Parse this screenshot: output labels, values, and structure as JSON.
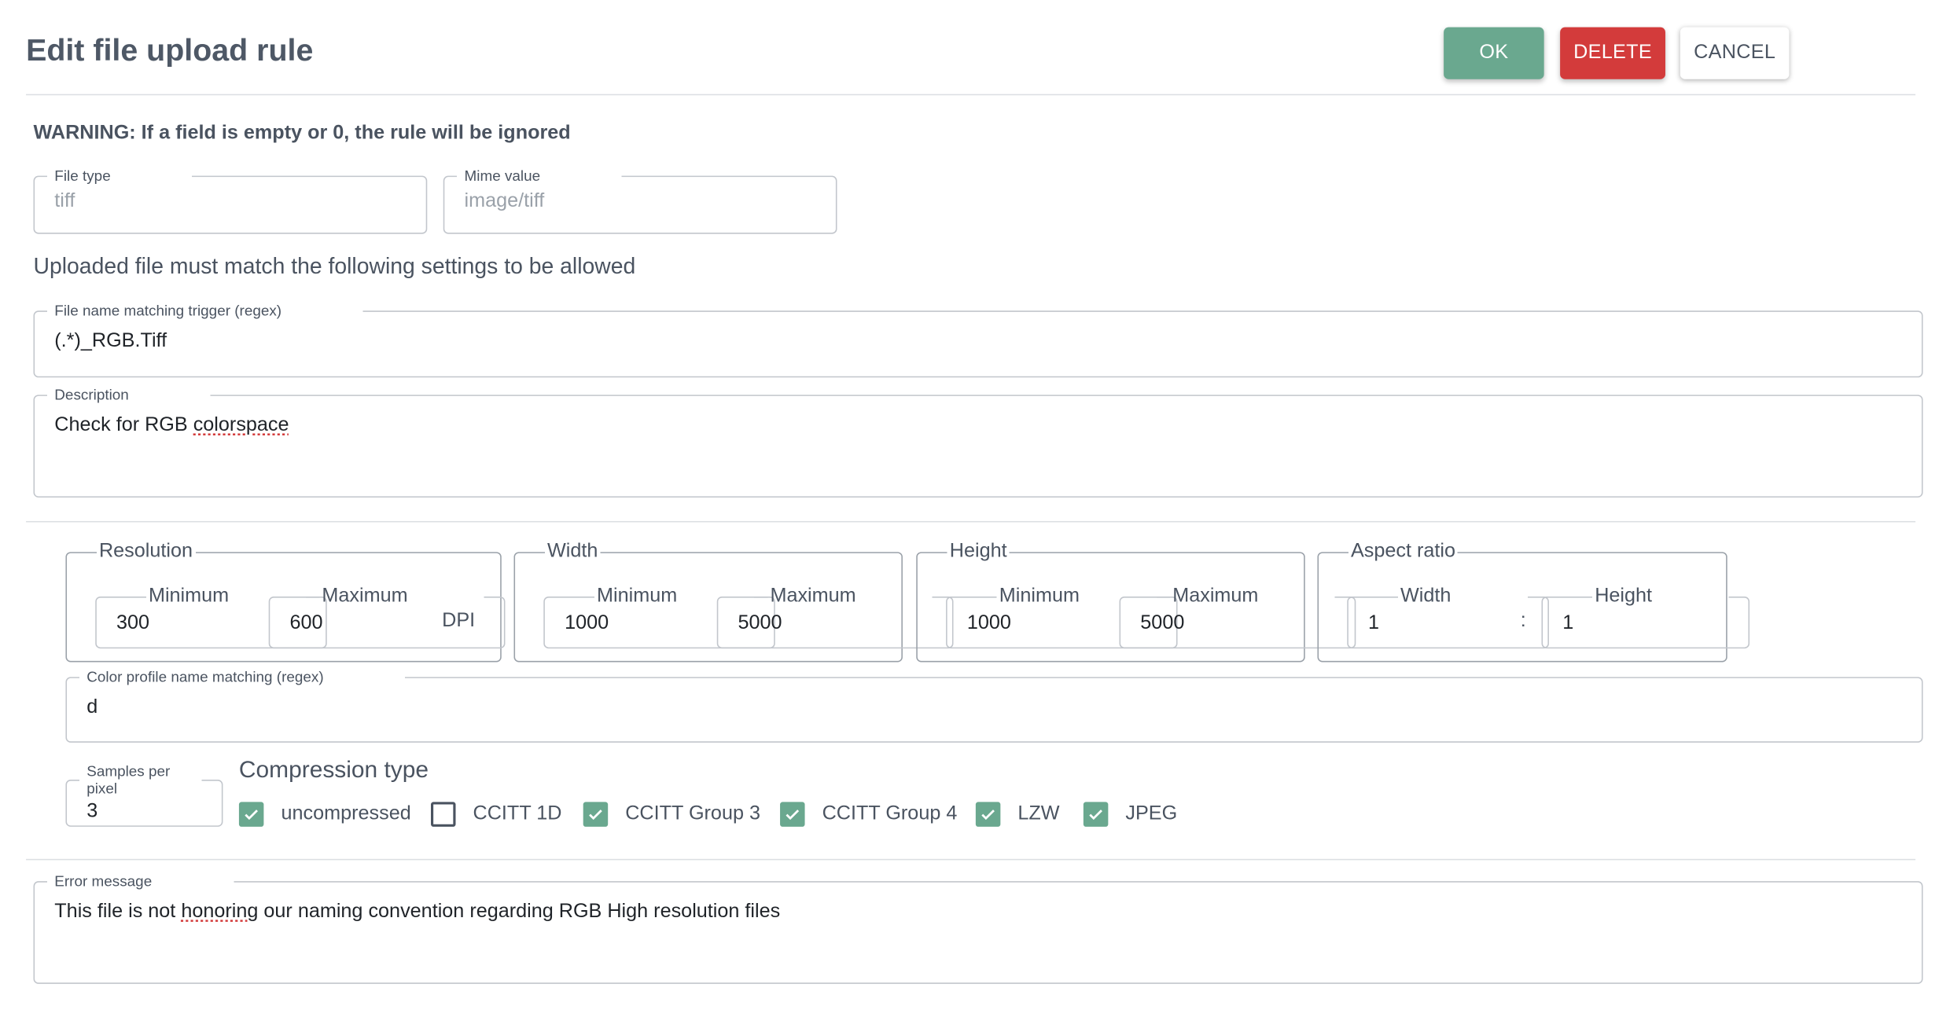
{
  "header": {
    "title": "Edit file upload rule",
    "ok_label": "OK",
    "delete_label": "DELETE",
    "cancel_label": "CANCEL"
  },
  "warning": "WARNING: If a field is empty or 0, the rule will be ignored",
  "file_type": {
    "label": "File type",
    "placeholder": "tiff"
  },
  "mime_value": {
    "label": "Mime value",
    "placeholder": "image/tiff"
  },
  "subheading": "Uploaded file must match the following settings to be allowed",
  "file_name_trigger": {
    "label": "File name matching trigger (regex)",
    "value": "(.*)_RGB.Tiff"
  },
  "description": {
    "label": "Description",
    "value_prefix": "Check for RGB ",
    "value_word": "colorspace"
  },
  "resolution": {
    "title": "Resolution",
    "min_label": "Minimum",
    "min_value": "300",
    "max_label": "Maximum",
    "max_value": "600",
    "unit": "DPI"
  },
  "width": {
    "title": "Width",
    "min_label": "Minimum",
    "min_value": "1000",
    "max_label": "Maximum",
    "max_value": "5000"
  },
  "height": {
    "title": "Height",
    "min_label": "Minimum",
    "min_value": "1000",
    "max_label": "Maximum",
    "max_value": "5000"
  },
  "aspect_ratio": {
    "title": "Aspect ratio",
    "width_label": "Width",
    "width_value": "1",
    "separator": ":",
    "height_label": "Height",
    "height_value": "1"
  },
  "color_profile": {
    "label": "Color profile name matching (regex)",
    "value": "d"
  },
  "samples_per_pixel": {
    "label": "Samples per pixel",
    "value": "3"
  },
  "compression": {
    "title": "Compression type",
    "options": [
      {
        "label": "uncompressed",
        "checked": true
      },
      {
        "label": "CCITT 1D",
        "checked": false
      },
      {
        "label": "CCITT Group 3",
        "checked": true
      },
      {
        "label": "CCITT Group 4",
        "checked": true
      },
      {
        "label": "LZW",
        "checked": true
      },
      {
        "label": "JPEG",
        "checked": true
      }
    ]
  },
  "error_message": {
    "label": "Error message",
    "value_prefix": "This file is not ",
    "value_word": "honoring",
    "value_suffix": " our naming convention regarding RGB High resolution files"
  },
  "colors": {
    "accent": "#6aa88f",
    "danger": "#d33b3b",
    "text": "#4a5360"
  }
}
